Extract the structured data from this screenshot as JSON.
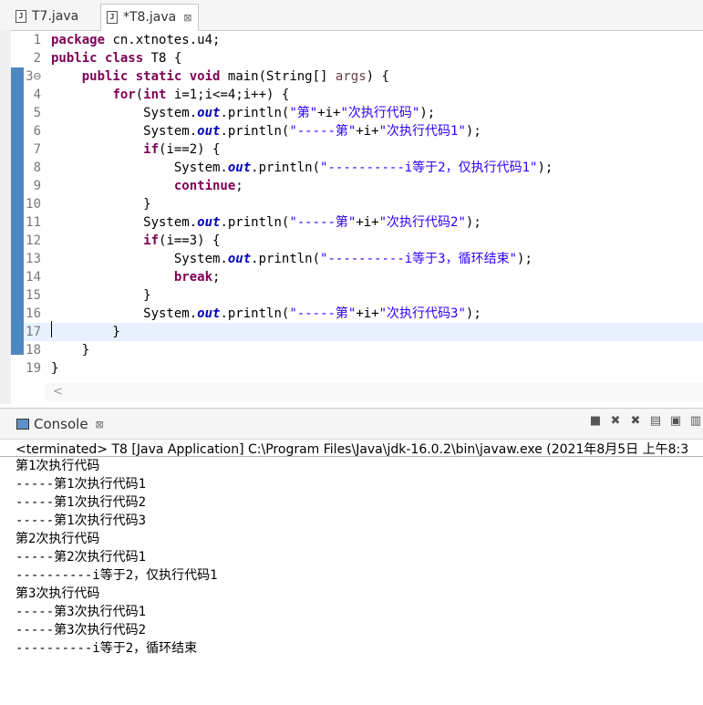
{
  "tabs": [
    {
      "label": "T7.java",
      "active": false
    },
    {
      "label": "*T8.java",
      "active": true
    }
  ],
  "tab_close_glyph": "⊠",
  "java_icon": "J",
  "code_lines": [
    {
      "n": "1",
      "segs": [
        {
          "c": "kw",
          "t": "package"
        },
        {
          "c": "",
          "t": " cn.xtnotes.u4;"
        }
      ]
    },
    {
      "n": "2",
      "segs": [
        {
          "c": "kw",
          "t": "public"
        },
        {
          "c": "",
          "t": " "
        },
        {
          "c": "kw",
          "t": "class"
        },
        {
          "c": "",
          "t": " T8 {"
        }
      ]
    },
    {
      "n": "3⊖",
      "segs": [
        {
          "c": "",
          "t": "    "
        },
        {
          "c": "kw",
          "t": "public"
        },
        {
          "c": "",
          "t": " "
        },
        {
          "c": "kw",
          "t": "static"
        },
        {
          "c": "",
          "t": " "
        },
        {
          "c": "kw",
          "t": "void"
        },
        {
          "c": "",
          "t": " main(String[] "
        },
        {
          "c": "arg",
          "t": "args"
        },
        {
          "c": "",
          "t": ") {"
        }
      ]
    },
    {
      "n": "4",
      "segs": [
        {
          "c": "",
          "t": "        "
        },
        {
          "c": "kw",
          "t": "for"
        },
        {
          "c": "",
          "t": "("
        },
        {
          "c": "kw",
          "t": "int"
        },
        {
          "c": "",
          "t": " i=1;i<=4;i++) {"
        }
      ]
    },
    {
      "n": "5",
      "segs": [
        {
          "c": "",
          "t": "            System."
        },
        {
          "c": "fld",
          "t": "out"
        },
        {
          "c": "",
          "t": ".println("
        },
        {
          "c": "str",
          "t": "\"第\""
        },
        {
          "c": "",
          "t": "+i+"
        },
        {
          "c": "str",
          "t": "\"次执行代码\""
        },
        {
          "c": "",
          "t": ");"
        }
      ]
    },
    {
      "n": "6",
      "segs": [
        {
          "c": "",
          "t": "            System."
        },
        {
          "c": "fld",
          "t": "out"
        },
        {
          "c": "",
          "t": ".println("
        },
        {
          "c": "str",
          "t": "\"-----第\""
        },
        {
          "c": "",
          "t": "+i+"
        },
        {
          "c": "str",
          "t": "\"次执行代码1\""
        },
        {
          "c": "",
          "t": ");"
        }
      ]
    },
    {
      "n": "7",
      "segs": [
        {
          "c": "",
          "t": "            "
        },
        {
          "c": "kw",
          "t": "if"
        },
        {
          "c": "",
          "t": "(i==2) {"
        }
      ]
    },
    {
      "n": "8",
      "segs": [
        {
          "c": "",
          "t": "                System."
        },
        {
          "c": "fld",
          "t": "out"
        },
        {
          "c": "",
          "t": ".println("
        },
        {
          "c": "str",
          "t": "\"----------i等于2，仅执行代码1\""
        },
        {
          "c": "",
          "t": ");"
        }
      ]
    },
    {
      "n": "9",
      "segs": [
        {
          "c": "",
          "t": "                "
        },
        {
          "c": "kw",
          "t": "continue"
        },
        {
          "c": "",
          "t": ";"
        }
      ]
    },
    {
      "n": "10",
      "segs": [
        {
          "c": "",
          "t": "            }"
        }
      ]
    },
    {
      "n": "11",
      "segs": [
        {
          "c": "",
          "t": "            System."
        },
        {
          "c": "fld",
          "t": "out"
        },
        {
          "c": "",
          "t": ".println("
        },
        {
          "c": "str",
          "t": "\"-----第\""
        },
        {
          "c": "",
          "t": "+i+"
        },
        {
          "c": "str",
          "t": "\"次执行代码2\""
        },
        {
          "c": "",
          "t": ");"
        }
      ]
    },
    {
      "n": "12",
      "segs": [
        {
          "c": "",
          "t": "            "
        },
        {
          "c": "kw",
          "t": "if"
        },
        {
          "c": "",
          "t": "(i==3) {"
        }
      ]
    },
    {
      "n": "13",
      "segs": [
        {
          "c": "",
          "t": "                System."
        },
        {
          "c": "fld",
          "t": "out"
        },
        {
          "c": "",
          "t": ".println("
        },
        {
          "c": "str",
          "t": "\"----------i等于3，循环结束\""
        },
        {
          "c": "",
          "t": ");"
        }
      ]
    },
    {
      "n": "14",
      "segs": [
        {
          "c": "",
          "t": "                "
        },
        {
          "c": "kw",
          "t": "break"
        },
        {
          "c": "",
          "t": ";"
        }
      ]
    },
    {
      "n": "15",
      "segs": [
        {
          "c": "",
          "t": "            }"
        }
      ]
    },
    {
      "n": "16",
      "segs": [
        {
          "c": "",
          "t": "            System."
        },
        {
          "c": "fld",
          "t": "out"
        },
        {
          "c": "",
          "t": ".println("
        },
        {
          "c": "str",
          "t": "\"-----第\""
        },
        {
          "c": "",
          "t": "+i+"
        },
        {
          "c": "str",
          "t": "\"次执行代码3\""
        },
        {
          "c": "",
          "t": ");"
        }
      ]
    },
    {
      "n": "17",
      "segs": [
        {
          "c": "",
          "t": "        }"
        }
      ],
      "current": true
    },
    {
      "n": "18",
      "segs": [
        {
          "c": "",
          "t": "    }"
        }
      ]
    },
    {
      "n": "19",
      "segs": [
        {
          "c": "",
          "t": "}"
        }
      ]
    }
  ],
  "console": {
    "title": "Console",
    "close_glyph": "⊠",
    "toolbar_icons": [
      "stop-icon",
      "remove-launch-icon",
      "remove-all-icon",
      "scroll-lock-icon",
      "pin-icon",
      "display-selected-icon"
    ],
    "status": "<terminated> T8 [Java Application] C:\\Program Files\\Java\\jdk-16.0.2\\bin\\javaw.exe (2021年8月5日 上午8:3",
    "output": [
      "第1次执行代码",
      "-----第1次执行代码1",
      "-----第1次执行代码2",
      "-----第1次执行代码3",
      "第2次执行代码",
      "-----第2次执行代码1",
      "----------i等于2，仅执行代码1",
      "第3次执行代码",
      "-----第3次执行代码1",
      "-----第3次执行代码2",
      "----------i等于2，循环结束"
    ]
  },
  "colors": {
    "keyword": "#7f0055",
    "string": "#2a00ff",
    "field": "#0000c0",
    "param": "#6a3e3e",
    "gutter_marker": "#4e88c1"
  }
}
